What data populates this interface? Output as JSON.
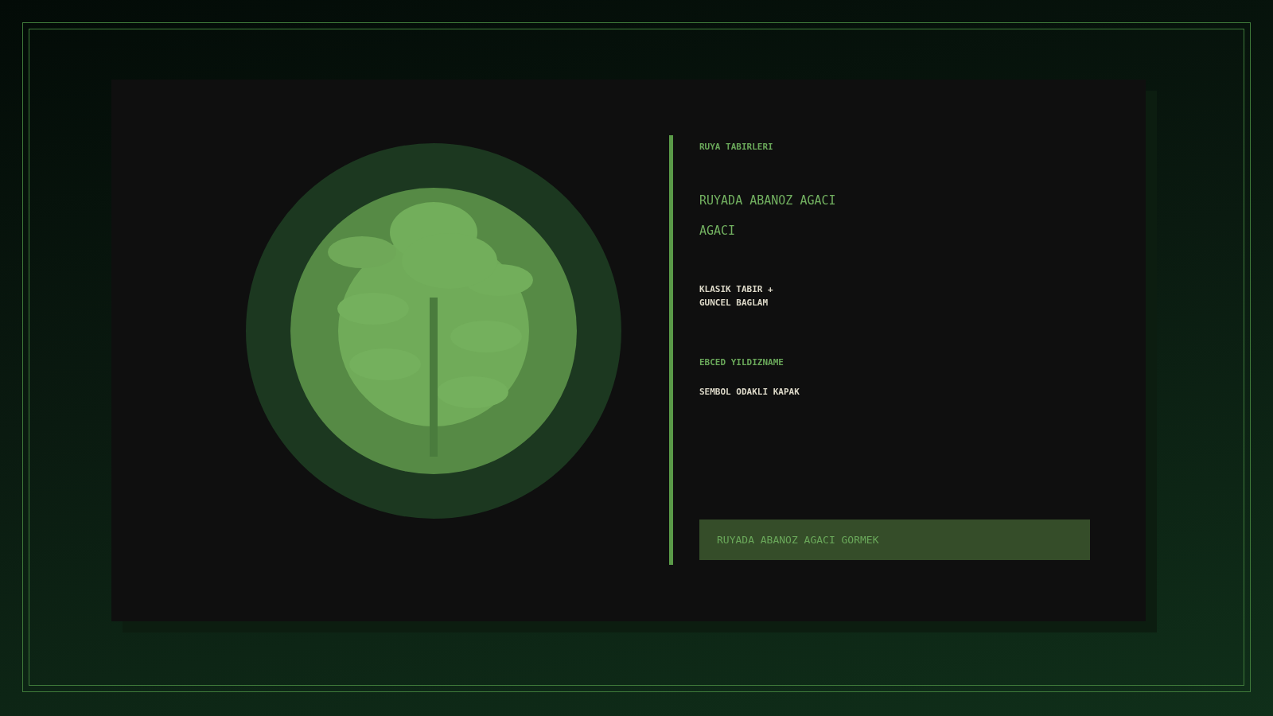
{
  "eyebrow": "RUYA TABIRLERI",
  "title_lines": [
    "RUYADA ABANOZ AGACI",
    "AGACI"
  ],
  "tagline_lines": [
    "KLASIK TABIR +",
    "GUNCEL BAGLAM"
  ],
  "brand": "EBCED YILDIZNAME",
  "caption": "SEMBOL ODAKLI KAPAK",
  "keyword": "RUYADA ABANOZ AGACI GORMEK"
}
